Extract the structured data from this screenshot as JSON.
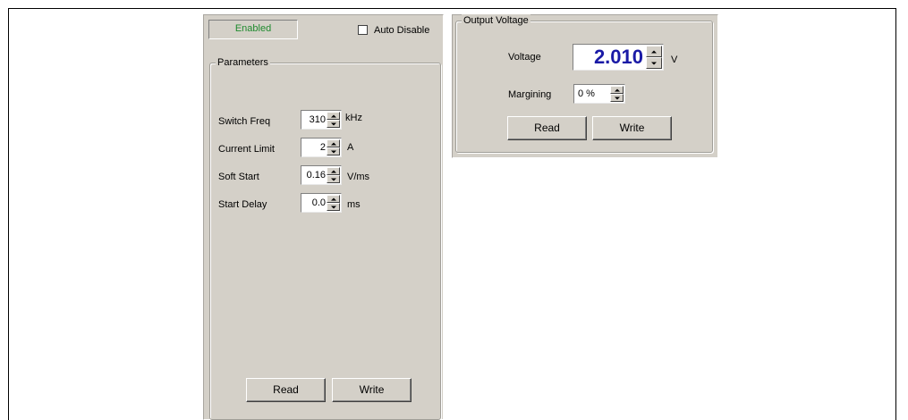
{
  "status": {
    "label": "Enabled",
    "color": "#1e8a2e"
  },
  "auto_disable": {
    "label": "Auto Disable",
    "checked": false
  },
  "parameters": {
    "title": "Parameters",
    "rows": [
      {
        "label": "Switch Freq",
        "value": "310",
        "unit": "kHz"
      },
      {
        "label": "Current Limit",
        "value": "2",
        "unit": "A"
      },
      {
        "label": "Soft Start",
        "value": "0.16",
        "unit": "V/ms"
      },
      {
        "label": "Start Delay",
        "value": "0.0",
        "unit": "ms"
      }
    ],
    "read_label": "Read",
    "write_label": "Write"
  },
  "output_voltage": {
    "title": "Output Voltage",
    "voltage_label": "Voltage",
    "voltage_value": "2.010",
    "voltage_unit": "V",
    "voltage_color": "#1a1aa6",
    "margining_label": "Margining",
    "margining_value": "0 %",
    "read_label": "Read",
    "write_label": "Write"
  },
  "icons": {
    "spin_up": "spin-up-arrow-icon",
    "spin_down": "spin-down-arrow-icon"
  }
}
